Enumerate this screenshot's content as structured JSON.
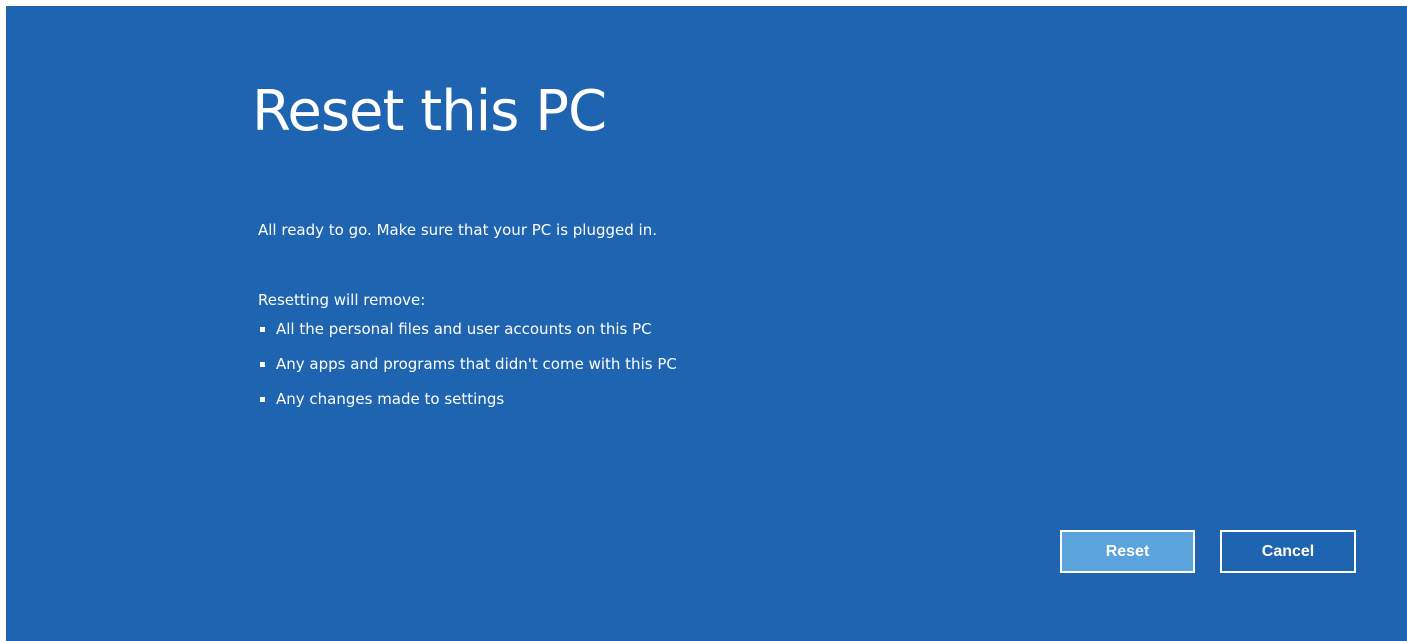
{
  "colors": {
    "background": "#1f64b0",
    "text": "#ffffff",
    "primary_button": "#5aa3db"
  },
  "dialog": {
    "title": "Reset this PC",
    "status": "All ready to go. Make sure that your PC is plugged in.",
    "remove_heading": "Resetting will remove:",
    "remove_items": [
      "All the personal files and user accounts on this PC",
      "Any apps and programs that didn't come with this PC",
      "Any changes made to settings"
    ]
  },
  "buttons": {
    "reset_label": "Reset",
    "cancel_label": "Cancel"
  }
}
